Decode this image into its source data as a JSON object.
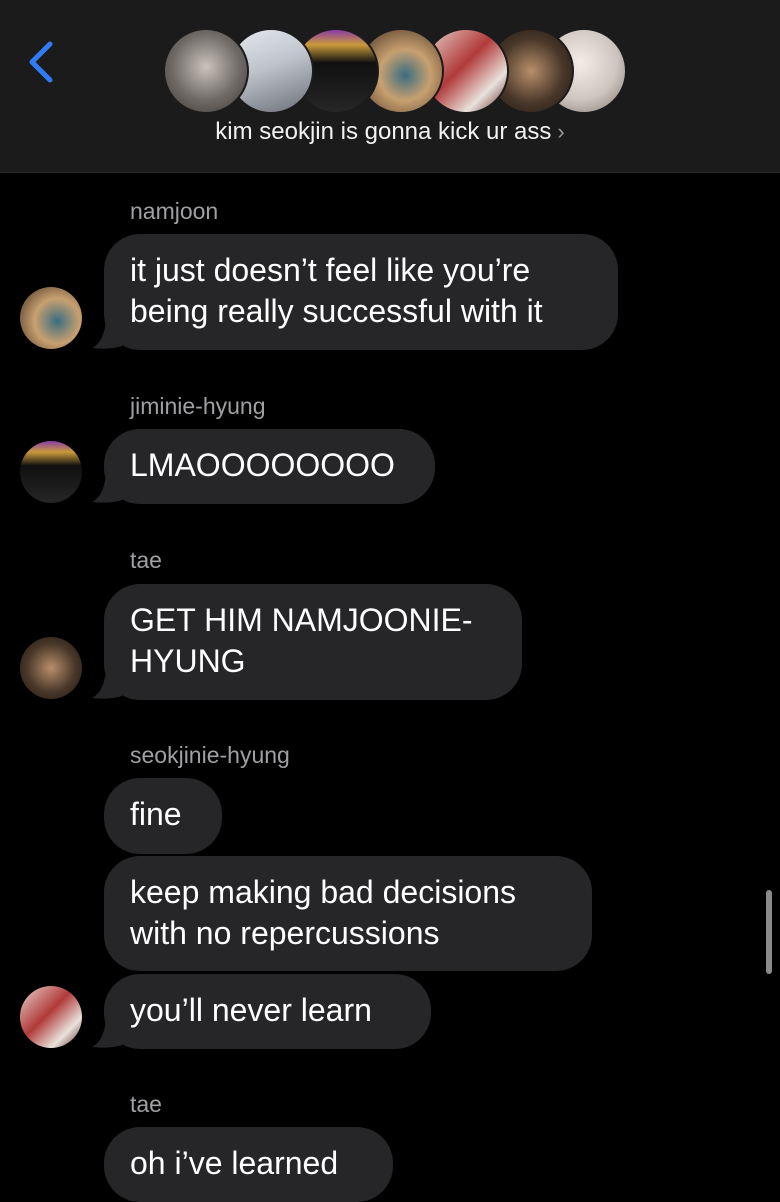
{
  "header": {
    "group_name": "kim seokjin is gonna kick ur ass",
    "chevron": "›"
  },
  "messages": [
    {
      "sender": "namjoon",
      "bubbles": [
        "it just doesn’t feel like you’re\nbeing really successful with it"
      ]
    },
    {
      "sender": "jiminie-hyung",
      "bubbles": [
        "LMAOOOOOOOO"
      ]
    },
    {
      "sender": "tae",
      "bubbles": [
        "GET HIM NAMJOONIE-\nHYUNG"
      ]
    },
    {
      "sender": "seokjinie-hyung",
      "bubbles": [
        "fine",
        "keep making bad decisions\nwith no repercussions",
        "you’ll never learn"
      ]
    },
    {
      "sender": "tae",
      "bubbles": [
        "oh i’ve learned"
      ]
    }
  ],
  "colors": {
    "header_bg": "#1c1b1c",
    "bubble_bg": "#262628",
    "accent_back": "#2f7cf6",
    "sender_text": "#a0a0a4"
  }
}
